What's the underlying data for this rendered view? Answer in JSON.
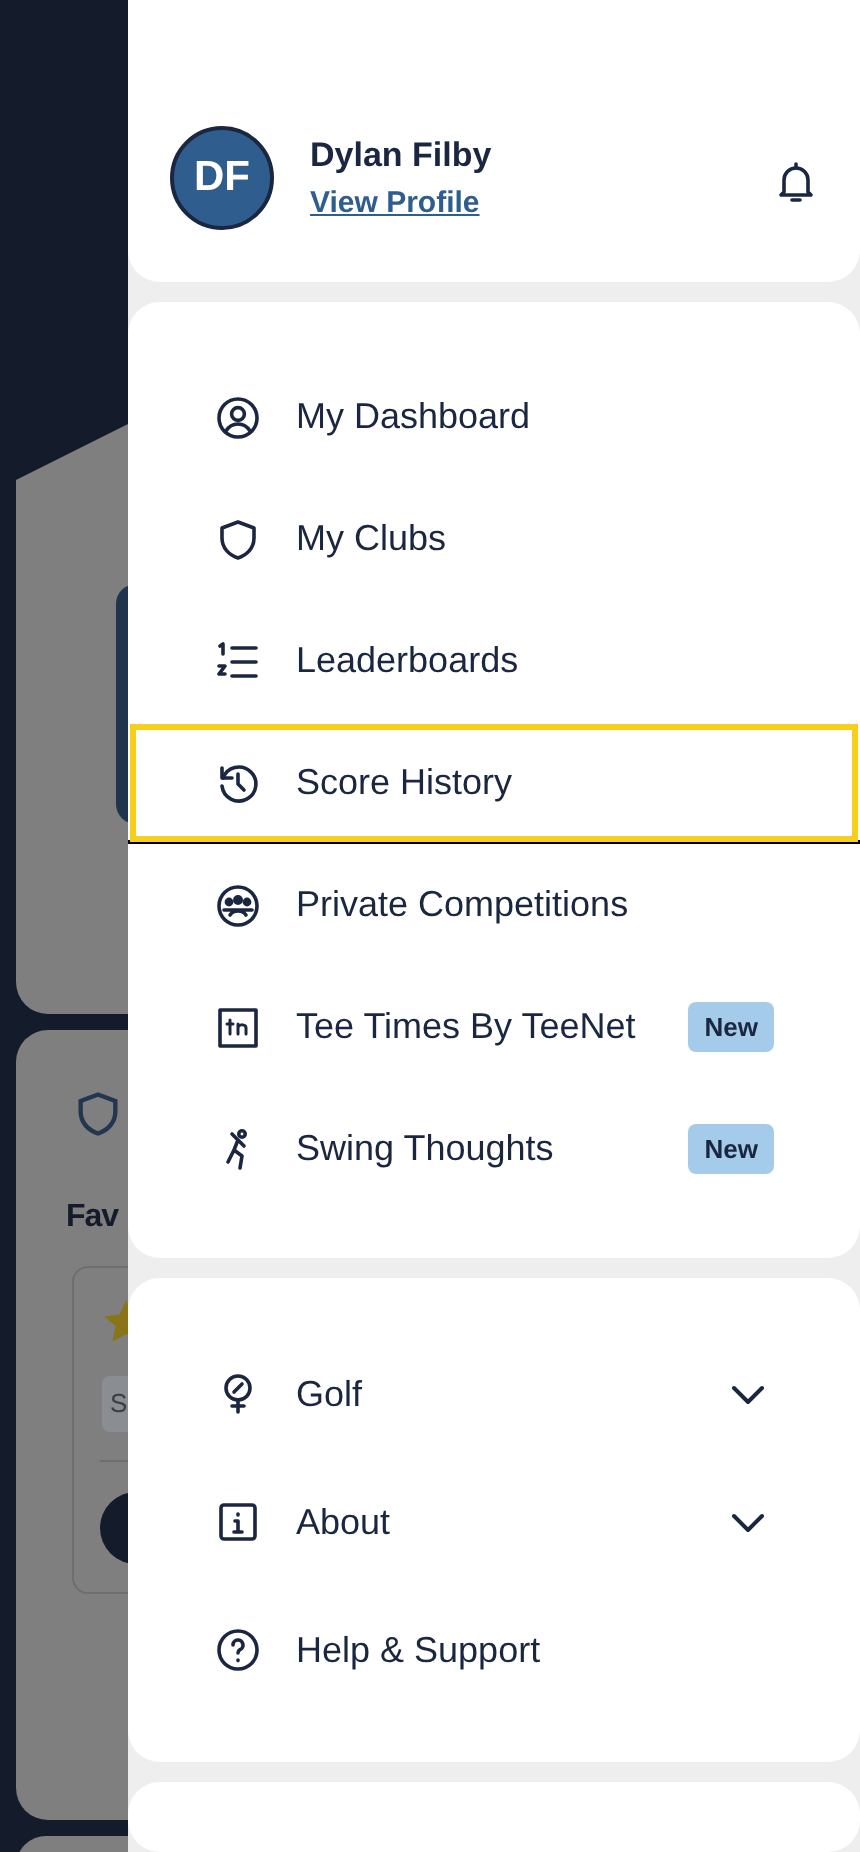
{
  "background_page": {
    "card_title": "Fav",
    "chip": "S"
  },
  "profile": {
    "initials": "DF",
    "name": "Dylan Filby",
    "link": "View Profile"
  },
  "menu": [
    {
      "kind": "dashboard",
      "label": "My Dashboard",
      "selected": false
    },
    {
      "kind": "clubs",
      "label": "My Clubs",
      "selected": false
    },
    {
      "kind": "leaderboards",
      "label": "Leaderboards",
      "selected": false
    },
    {
      "kind": "history",
      "label": "Score History",
      "selected": true
    },
    {
      "kind": "competitions",
      "label": "Private Competitions",
      "selected": false
    },
    {
      "kind": "teetimes",
      "label": "Tee Times By TeeNet",
      "selected": false,
      "badge": "New"
    },
    {
      "kind": "swing",
      "label": "Swing Thoughts",
      "selected": false,
      "badge": "New"
    }
  ],
  "secondary_menu": [
    {
      "kind": "golf",
      "label": "Golf",
      "expanded": false
    },
    {
      "kind": "about",
      "label": "About",
      "expanded": false
    },
    {
      "kind": "help",
      "label": "Help & Support"
    }
  ]
}
